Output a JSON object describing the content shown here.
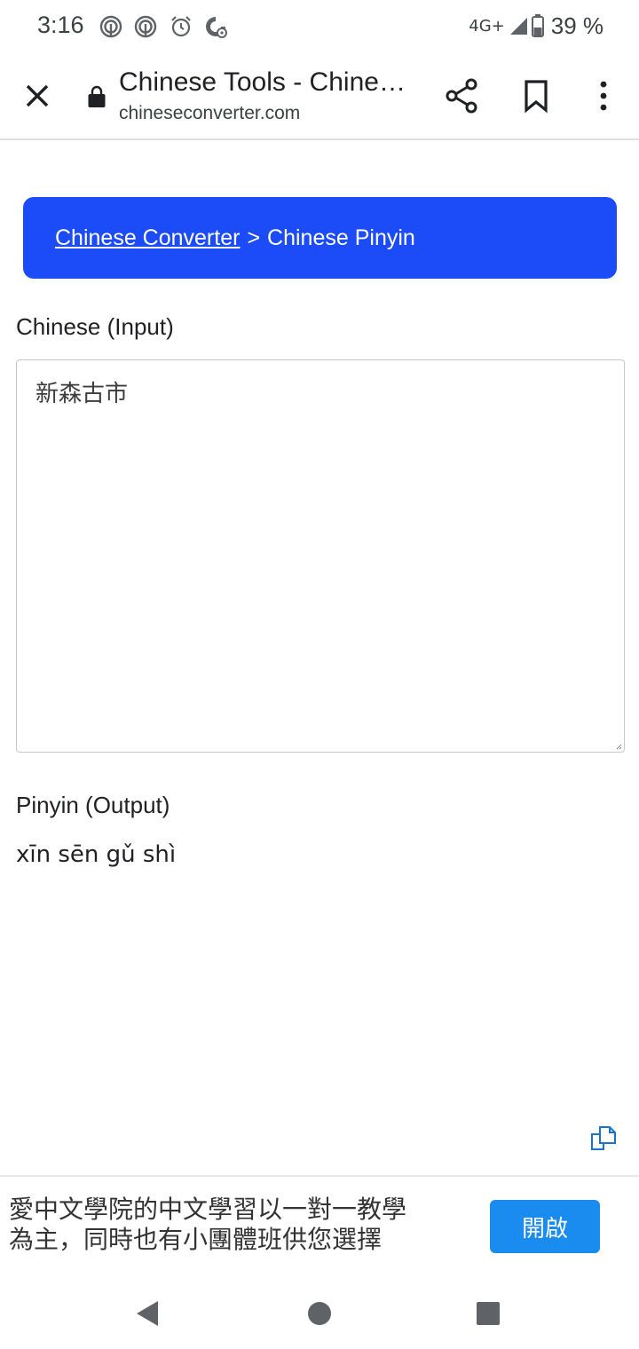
{
  "status_bar": {
    "time": "3:16",
    "network": "4G+",
    "battery": "39 %",
    "icons": [
      "signal-radar-icon",
      "signal-radar-icon",
      "alarm-icon",
      "data-saver-icon",
      "cell-signal-icon",
      "battery-icon"
    ]
  },
  "browser": {
    "close_icon": "close-icon",
    "page_title": "Chinese Tools - Chine…",
    "url": "chineseconverter.com",
    "actions": [
      "share-icon",
      "bookmark-icon",
      "more-vert-icon"
    ]
  },
  "breadcrumb": {
    "link": "Chinese Converter",
    "separator": ">",
    "current": "Chinese Pinyin"
  },
  "input": {
    "label": "Chinese (Input)",
    "value": "新森古市"
  },
  "output": {
    "label": "Pinyin (Output)",
    "value": "xīn sēn gǔ shì"
  },
  "ad": {
    "text_line1": "愛中文學院的中文學習以一對一教學",
    "text_line2": "為主，同時也有小團體班供您選擇",
    "button": "開啟"
  },
  "nav": [
    "back-icon",
    "home-icon",
    "recents-icon"
  ],
  "colors": {
    "banner": "#1c4cf8",
    "ad_button": "#1a8cf0",
    "copy_icon": "#1a73c8"
  }
}
